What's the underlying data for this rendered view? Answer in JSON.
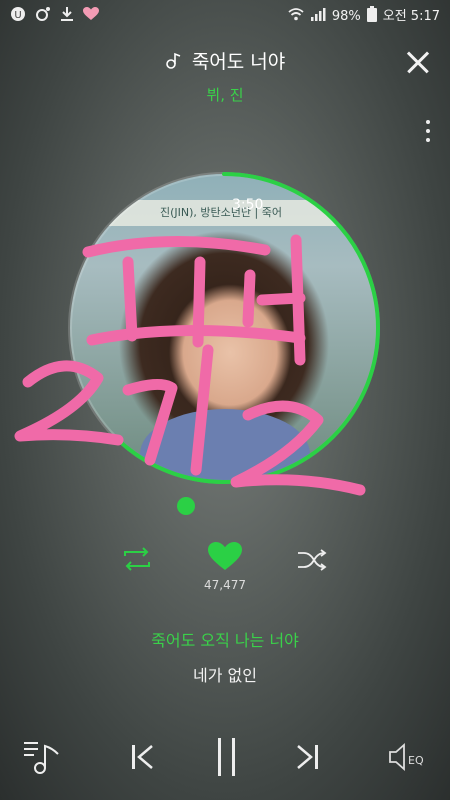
{
  "status_bar": {
    "battery_percent": "98%",
    "time": "오전 5:17",
    "left_icons": [
      "u-icon",
      "music-note-icon",
      "download-icon",
      "heart-icon"
    ],
    "right_icons": [
      "wifi-icon",
      "signal-icon",
      "battery-icon"
    ]
  },
  "header": {
    "title": "죽어도 너야",
    "artist": "뷔, 진"
  },
  "player": {
    "time_remaining": "3:50",
    "progress_fraction": 0.62,
    "album_banner_text": "진(JIN), 방탄소년단  |  죽어",
    "like_count": "47,477"
  },
  "lyrics": {
    "current": "죽어도 오직 나는 너야",
    "next": "네가 없인"
  },
  "doodle": {
    "color": "#f06aa8",
    "text": "꼬레 2기2"
  },
  "colors": {
    "accent": "#2bd045",
    "doodle_pink": "#f06aa8"
  },
  "bottom_bar": {
    "eq_label": "EQ"
  }
}
